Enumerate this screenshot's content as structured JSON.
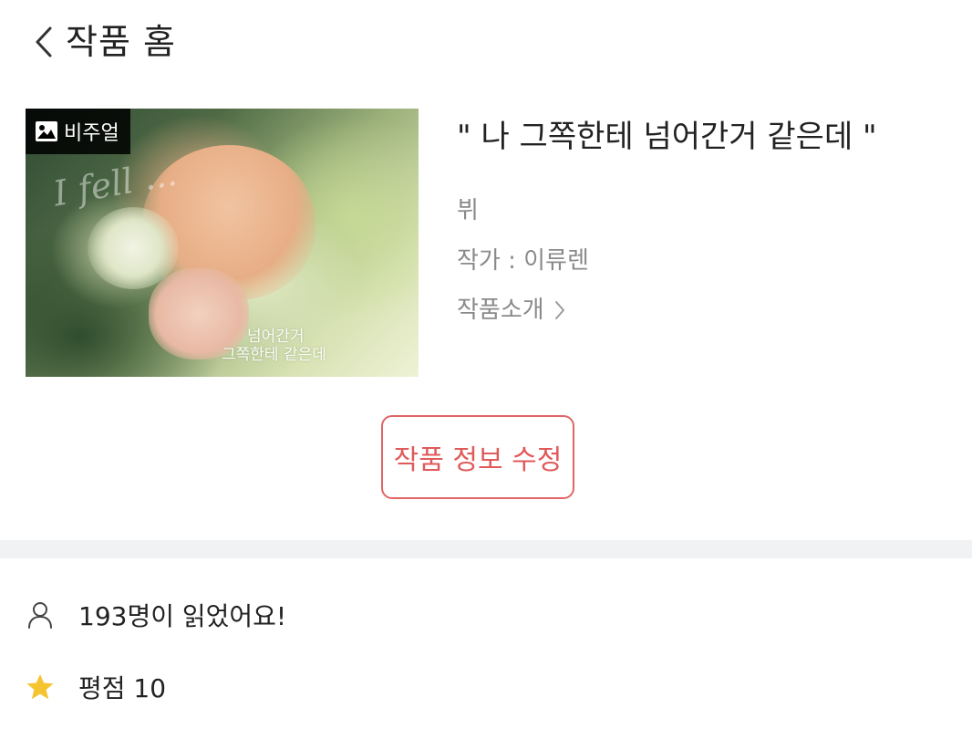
{
  "header": {
    "back_icon": "chevron-left-icon",
    "title": "작품 홈"
  },
  "cover": {
    "badge_icon": "image-icon",
    "badge_label": "비주얼",
    "overlay_script": "I fell ...",
    "overlay_line1": "넘어간거",
    "overlay_line2": "그쪽한테 같은데"
  },
  "work": {
    "title": "\" 나 그쪽한테 넘어간거 같은데  \"",
    "genre": "뷔",
    "author": "작가 : 이류렌",
    "intro_label": "작품소개",
    "intro_icon": "chevron-right-icon"
  },
  "actions": {
    "edit_label": "작품 정보 수정",
    "edit_color": "#e05a5a"
  },
  "stats": {
    "readers_icon": "person-icon",
    "readers_text": "193명이 읽었어요!",
    "rating_icon": "star-icon",
    "rating_text": "평점 10",
    "star_color": "#f5c431"
  }
}
